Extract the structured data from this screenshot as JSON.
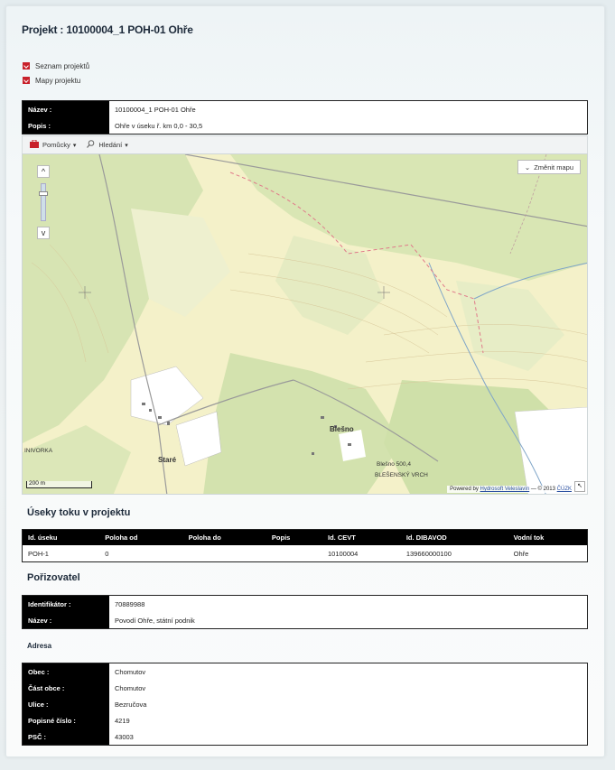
{
  "page": {
    "title": "Projekt : 10100004_1 POH-01 Ohře"
  },
  "links": [
    {
      "label": "Seznam projektů"
    },
    {
      "label": "Mapy projektu"
    }
  ],
  "info": {
    "rows": [
      {
        "key": "Název :",
        "value": "10100004_1 POH-01 Ohře"
      },
      {
        "key": "Popis :",
        "value": "Ohře v úseku ř. km 0,0 - 30,5"
      }
    ]
  },
  "map_toolbar": {
    "tools_label": "Pomůcky",
    "search_label": "Hledání"
  },
  "map": {
    "change_map_label": "Změnit mapu",
    "scale_label": "200 m",
    "attribution_prefix": "Powered by",
    "attribution_link": "Hydrosoft Veleslavín",
    "attribution_suffix": "— © 2013",
    "attribution_link2": "ČÚZK",
    "zoom_in": "^",
    "zoom_out": "v",
    "place_labels": [
      "Blešno",
      "Staré",
      "BLEŠENSKÝ VRCH",
      "INIVORKA",
      "Blešno 500,4"
    ],
    "colors": {
      "base": "#f4f1c9",
      "forest": "#d7e4b3",
      "meadow": "#e9ecc7",
      "urban": "#ffffff",
      "boundary": "#e07a8a",
      "road": "#9a9a9a"
    }
  },
  "segments": {
    "heading": "Úseky toku v projektu",
    "columns": [
      "Id. úseku",
      "Poloha od",
      "Poloha do",
      "Popis",
      "Id. CEVT",
      "Id. DIBAVOD",
      "Vodní tok"
    ],
    "rows": [
      [
        "POH-1",
        "0",
        "",
        "",
        "10100004",
        "139660000100",
        "Ohře"
      ]
    ]
  },
  "porizovatel": {
    "heading": "Pořizovatel",
    "rows": [
      {
        "key": "Identifikátor :",
        "value": "70889988"
      },
      {
        "key": "Název :",
        "value": "Povodí Ohře, státní podnik"
      }
    ]
  },
  "adresa": {
    "heading": "Adresa",
    "rows": [
      {
        "key": "Obec :",
        "value": "Chomutov"
      },
      {
        "key": "Část obce :",
        "value": "Chomutov"
      },
      {
        "key": "Ulice :",
        "value": "Bezručova"
      },
      {
        "key": "Popisné číslo :",
        "value": "4219"
      },
      {
        "key": "PSČ :",
        "value": "43003"
      }
    ]
  }
}
